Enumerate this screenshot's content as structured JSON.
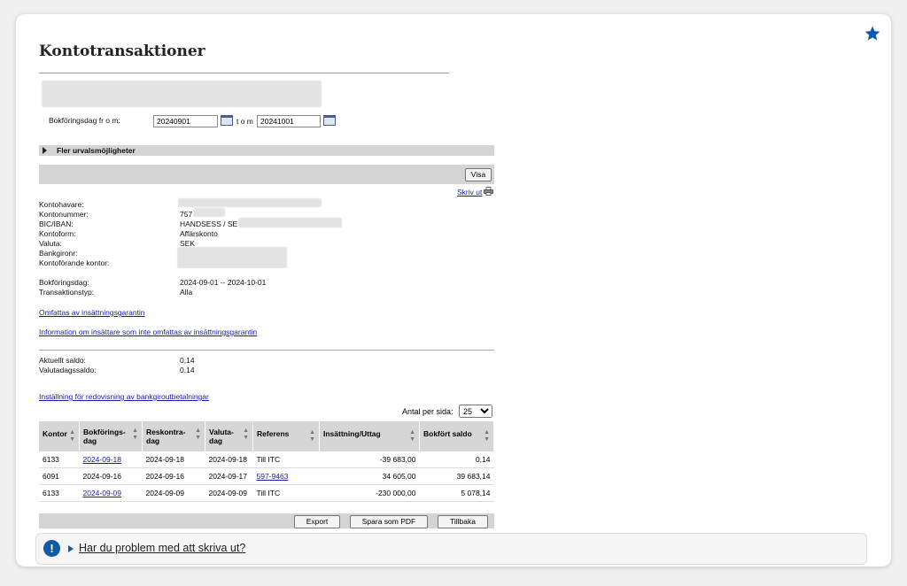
{
  "page": {
    "title": "Kontotransaktioner"
  },
  "filter": {
    "from_label": "Bokföringsdag fr o m:",
    "from_value": "20240901",
    "to_label": "t o m",
    "to_value": "20241001",
    "more_options": "Fler urvalsmöjligheter",
    "show_button": "Visa",
    "print_link": "Skriv ut"
  },
  "account": {
    "rows": [
      {
        "label": "Kontohavare:",
        "value": ""
      },
      {
        "label": "Kontonummer:",
        "value": "757"
      },
      {
        "label": "BIC/IBAN:",
        "value": "HANDSESS / SE"
      },
      {
        "label": "Kontoform:",
        "value": "Affärskonto"
      },
      {
        "label": "Valuta:",
        "value": "SEK"
      },
      {
        "label": "Bankgironr:",
        "value": ""
      },
      {
        "label": "Kontoförande kontor:",
        "value": ""
      }
    ],
    "period_label": "Bokföringsdag:",
    "period_value": "2024-09-01 -- 2024-10-01",
    "type_label": "Transaktionstyp:",
    "type_value": "Alla"
  },
  "links": {
    "guarantee": "Omfattas av insättningsgarantin",
    "not_guarantee": "Information om insättare som inte omfattas av insättningsgarantin",
    "bankgiro": "Inställning för redovisning av bankgiroutbetalningar"
  },
  "balance": {
    "current_label": "Aktuellt saldo:",
    "current_value": "0,14",
    "value_date_label": "Valutadagssaldo:",
    "value_date_value": "0,14"
  },
  "table": {
    "per_page_label": "Antal per sida:",
    "per_page_value": "25",
    "headers": [
      "Kontor",
      "Bokförings-dag",
      "Reskontra-dag",
      "Valuta-dag",
      "Referens",
      "Insättning/Uttag",
      "Bokfört saldo"
    ],
    "rows": [
      [
        "6133",
        "2024-09-18",
        "2024-09-18",
        "2024-09-18",
        "Till ITC",
        "-39 683,00",
        "0,14"
      ],
      [
        "6091",
        "2024-09-16",
        "2024-09-16",
        "2024-09-17",
        "597-9463",
        "34 605,00",
        "39 683,14"
      ],
      [
        "6133",
        "2024-09-09",
        "2024-09-09",
        "2024-09-09",
        "Till ITC",
        "-230 000,00",
        "5 078,14"
      ]
    ]
  },
  "footer_buttons": {
    "export": "Export",
    "pdf": "Spara som PDF",
    "back": "Tillbaka"
  },
  "help": {
    "text": "Har du problem med att skriva ut?"
  },
  "colors": {
    "accent": "#0e5aa7",
    "link": "#1a1aa6",
    "bar": "#d4d4d4"
  }
}
